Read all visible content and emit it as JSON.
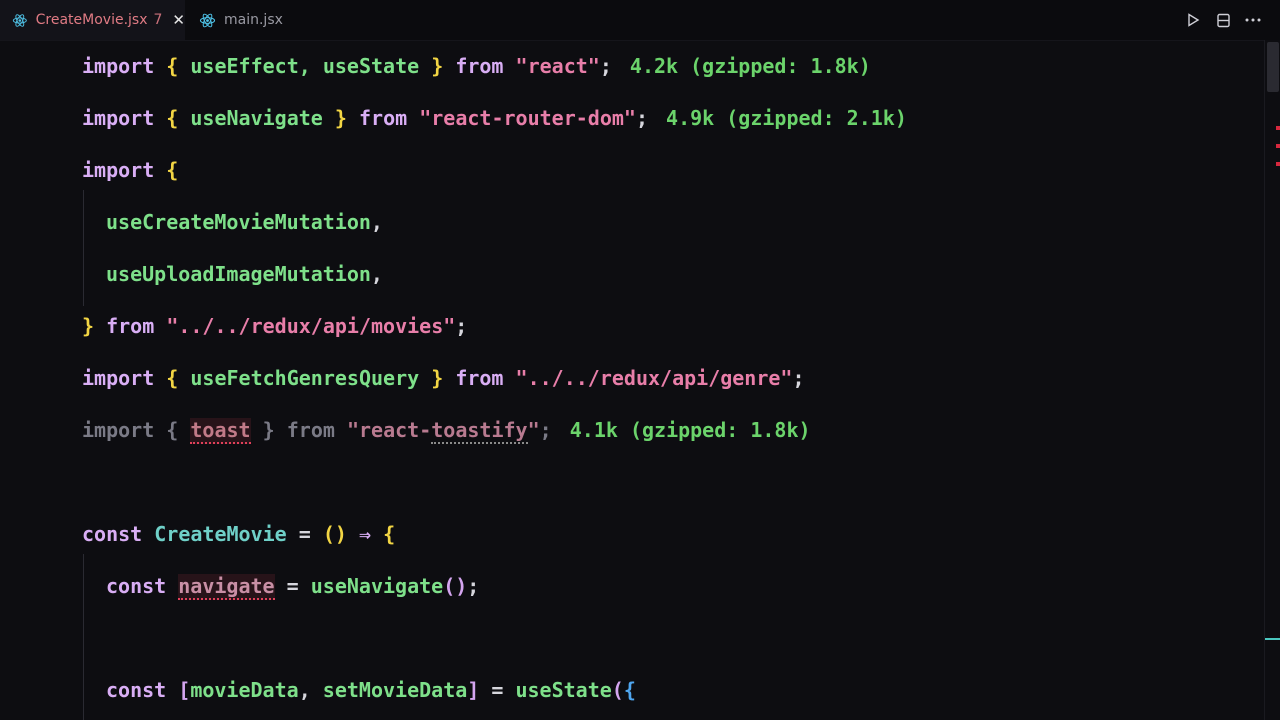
{
  "tabs": [
    {
      "label": "CreateMovie.jsx",
      "badge": "7",
      "active": true,
      "icon": "react-icon"
    },
    {
      "label": "main.jsx",
      "active": false,
      "icon": "react-icon"
    }
  ],
  "toolbar": {
    "icons": [
      "run-icon",
      "split-editor-icon",
      "more-actions-icon"
    ]
  },
  "code": {
    "l1": {
      "kw": "import",
      "ob": "{",
      "names": "useEffect, useState",
      "cb": "}",
      "from": "from",
      "src": "\"react\"",
      "semi": ";",
      "hint": "4.2k (gzipped: 1.8k)"
    },
    "l2": {
      "kw": "import",
      "ob": "{",
      "names": "useNavigate",
      "cb": "}",
      "from": "from",
      "src": "\"react-router-dom\"",
      "semi": ";",
      "hint": "4.9k (gzipped: 2.1k)"
    },
    "l3": {
      "kw": "import",
      "ob": "{"
    },
    "l4": {
      "name": "useCreateMovieMutation",
      "comma": ","
    },
    "l5": {
      "name": "useUploadImageMutation",
      "comma": ","
    },
    "l6": {
      "cb": "}",
      "from": "from",
      "src": "\"../../redux/api/movies\"",
      "semi": ";"
    },
    "l7": {
      "kw": "import",
      "ob": "{",
      "names": "useFetchGenresQuery",
      "cb": "}",
      "from": "from",
      "src": "\"../../redux/api/genre\"",
      "semi": ";"
    },
    "l8": {
      "kw": "import",
      "ob": "{",
      "names": "toast",
      "cb": "}",
      "from": "from",
      "src1": "\"react-",
      "src2": "toastify",
      "src3": "\"",
      "semi": ";",
      "hint": "4.1k (gzipped: 1.8k)"
    },
    "l9": {
      "kw": "const",
      "name": "CreateMovie",
      "eq": "=",
      "parens": "()",
      "arrow": "⇒",
      "ob": "{"
    },
    "l10": {
      "kw": "const",
      "name": "navigate",
      "eq": "=",
      "fn": "useNavigate",
      "call": "()",
      "semi": ";"
    },
    "l11": {
      "kw": "const",
      "lb": "[",
      "a": "movieData",
      "comma": ",",
      "b": "setMovieData",
      "rb": "]",
      "eq": "=",
      "fn": "useState",
      "paren": "(",
      "ob": "{"
    }
  },
  "colors": {
    "keyword": "#d9aef5",
    "identifier": "#7ee08a",
    "string": "#e87ea9",
    "bracket": "#f2d544",
    "hint": "#6bd36b",
    "active_tab": "#e07b84"
  }
}
